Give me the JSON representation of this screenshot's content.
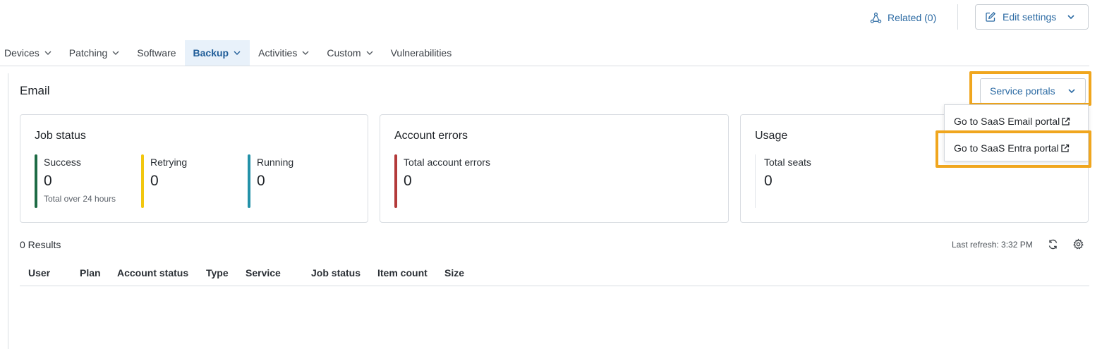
{
  "header": {
    "related_label": "Related (0)",
    "edit_settings_label": "Edit settings"
  },
  "tabs": [
    {
      "label": "Devices",
      "has_menu": true
    },
    {
      "label": "Patching",
      "has_menu": true
    },
    {
      "label": "Software",
      "has_menu": false
    },
    {
      "label": "Backup",
      "has_menu": true,
      "active": true
    },
    {
      "label": "Activities",
      "has_menu": true
    },
    {
      "label": "Custom",
      "has_menu": true
    },
    {
      "label": "Vulnerabilities",
      "has_menu": false
    }
  ],
  "section": {
    "title": "Email",
    "service_portals_label": "Service portals"
  },
  "portal_menu": {
    "items": [
      {
        "label": "Go to SaaS Email portal",
        "icon": "external-link-icon"
      },
      {
        "label": "Go to SaaS Entra portal",
        "icon": "external-link-icon"
      }
    ]
  },
  "cards": {
    "job_status": {
      "title": "Job status",
      "metrics": [
        {
          "label": "Success",
          "value": "0",
          "sub": "Total over 24 hours",
          "color": "#1e6b45"
        },
        {
          "label": "Retrying",
          "value": "0",
          "color": "#f2c70f"
        },
        {
          "label": "Running",
          "value": "0",
          "color": "#2391a8"
        }
      ]
    },
    "account_errors": {
      "title": "Account errors",
      "metrics": [
        {
          "label": "Total account errors",
          "value": "0",
          "color": "#b33a3a"
        }
      ]
    },
    "usage": {
      "title": "Usage",
      "metrics": [
        {
          "label": "Total seats",
          "value": "0",
          "color": "#d9dde2"
        }
      ]
    }
  },
  "results": {
    "count_label": "0 Results",
    "last_refresh": "Last refresh: 3:32 PM"
  },
  "table": {
    "columns": [
      "User",
      "Plan",
      "Account status",
      "Type",
      "Service",
      "Job status",
      "Item count",
      "Size"
    ],
    "rows": []
  },
  "colors": {
    "accent": "#2b6aa3",
    "highlight": "#f0a61e",
    "active_tab_bg": "#e8f1fa"
  }
}
